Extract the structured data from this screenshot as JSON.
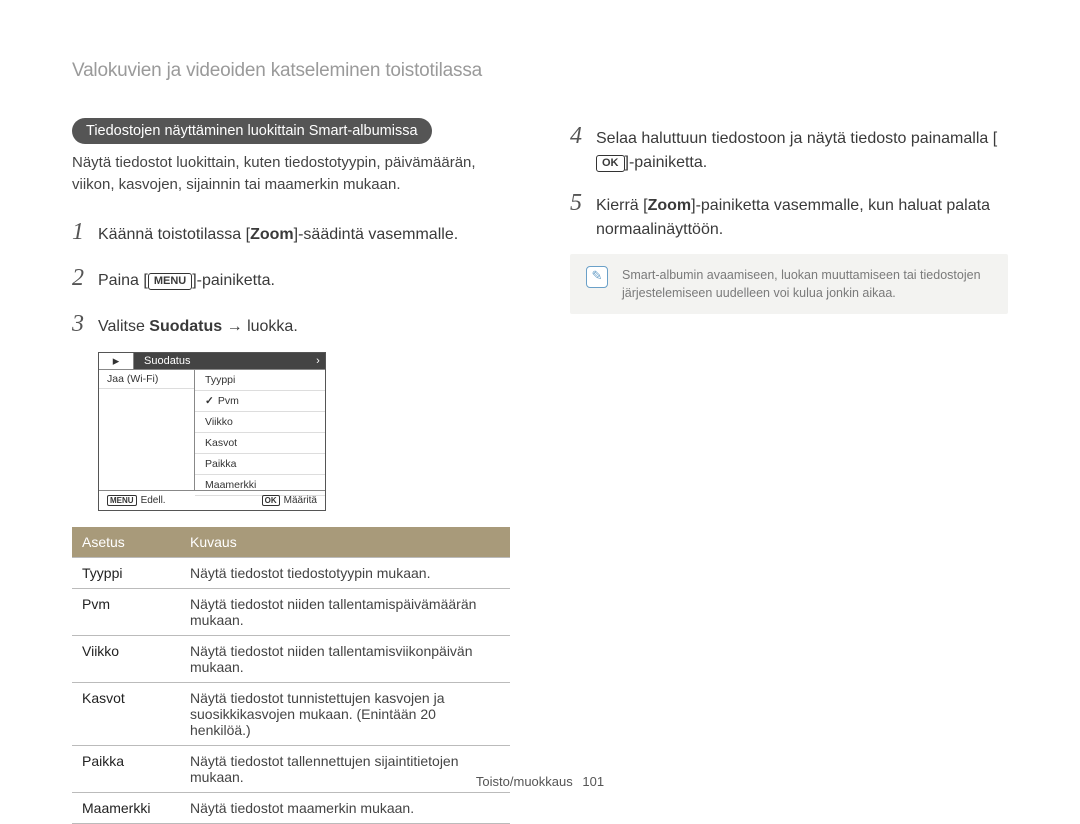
{
  "page_title": "Valokuvien ja videoiden katseleminen toistotilassa",
  "section_pill": "Tiedostojen näyttäminen luokittain Smart-albumissa",
  "intro": "Näytä tiedostot luokittain, kuten tiedostotyypin, päivämäärän, viikon, kasvojen, sijainnin tai maamerkin mukaan.",
  "steps": {
    "1": {
      "pre": "Käännä toistotilassa [",
      "b": "Zoom",
      "post": "]-säädintä vasemmalle."
    },
    "2": {
      "pre": "Paina [",
      "key": "MENU",
      "post": "]-painiketta."
    },
    "3": {
      "pre": "Valitse ",
      "b": "Suodatus",
      "post": " → luokka."
    },
    "4": {
      "pre": "Selaa haluttuun tiedostoon ja näytä tiedosto painamalla [",
      "key": "OK",
      "post": "]-painiketta."
    },
    "5": {
      "pre": "Kierrä [",
      "b": "Zoom",
      "post": "]-painiketta vasemmalle, kun haluat palata normaalinäyttöön."
    }
  },
  "screenshot": {
    "head_label": "Suodatus",
    "left_items": [
      "Jaa (Wi-Fi)"
    ],
    "right_items": [
      "Tyyppi",
      "Pvm",
      "Viikko",
      "Kasvot",
      "Paikka",
      "Maamerkki"
    ],
    "selected": "Pvm",
    "foot_left_key": "MENU",
    "foot_left": "Edell.",
    "foot_right_key": "OK",
    "foot_right": "Määritä"
  },
  "table": {
    "head": [
      "Asetus",
      "Kuvaus"
    ],
    "rows": [
      [
        "Tyyppi",
        "Näytä tiedostot tiedostotyypin mukaan."
      ],
      [
        "Pvm",
        "Näytä tiedostot niiden tallentamispäivämäärän mukaan."
      ],
      [
        "Viikko",
        "Näytä tiedostot niiden tallentamisviikonpäivän mukaan."
      ],
      [
        "Kasvot",
        "Näytä tiedostot tunnistettujen kasvojen ja suosikkikasvojen mukaan. (Enintään 20 henkilöä.)"
      ],
      [
        "Paikka",
        "Näytä tiedostot tallennettujen sijaintitietojen mukaan."
      ],
      [
        "Maamerkki",
        "Näytä tiedostot maamerkin mukaan."
      ]
    ]
  },
  "note": "Smart-albumin avaamiseen, luokan muuttamiseen tai tiedostojen järjestelemiseen uudelleen voi kulua jonkin aikaa.",
  "footer": {
    "section": "Toisto/muokkaus",
    "page": "101"
  }
}
